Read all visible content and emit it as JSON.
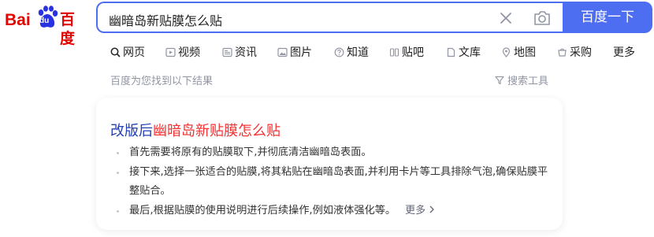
{
  "brand": {
    "logo_part1": "Bai",
    "logo_paw": "du",
    "logo_part2": "百度"
  },
  "search": {
    "query": "幽暗岛新贴膜怎么贴",
    "button_label": "百度一下"
  },
  "tabs": [
    {
      "label": "网页",
      "icon": "search-icon",
      "active": true
    },
    {
      "label": "视频",
      "icon": "video-icon"
    },
    {
      "label": "资讯",
      "icon": "news-icon"
    },
    {
      "label": "图片",
      "icon": "image-icon"
    },
    {
      "label": "知道",
      "icon": "question-icon"
    },
    {
      "label": "贴吧",
      "icon": "tieba-icon"
    },
    {
      "label": "文库",
      "icon": "document-icon"
    },
    {
      "label": "地图",
      "icon": "map-pin-icon"
    },
    {
      "label": "采购",
      "icon": "cart-icon"
    },
    {
      "label": "更多"
    }
  ],
  "results_meta": {
    "count_text": "百度为您找到以下结果",
    "tools_label": "搜索工具"
  },
  "result": {
    "title_prefix": "改版后",
    "title_keyword": "幽暗岛新贴膜怎么贴",
    "bullets": [
      "首先需要将原有的贴膜取下,并彻底清洁幽暗岛表面。",
      "接下来,选择一张适合的贴膜,将其粘贴在幽暗岛表面,并利用卡片等工具排除气泡,确保贴膜平整贴合。",
      "最后,根据贴膜的使用说明进行后续操作,例如液体强化等。"
    ],
    "more_label": "更多"
  },
  "colors": {
    "accent": "#4e6ef2",
    "brand_red": "#e10601",
    "title_blue": "#2440b3",
    "keyword_red": "#f73131"
  }
}
